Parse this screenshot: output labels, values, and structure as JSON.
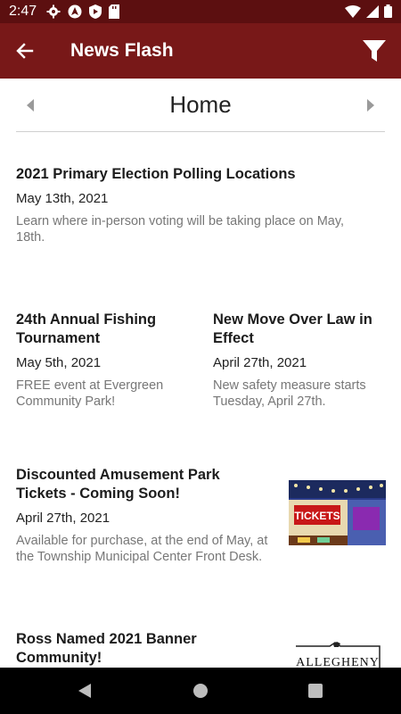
{
  "status_bar": {
    "time": "2:47",
    "left_icons": [
      "gear-icon",
      "autopilot-icon",
      "shield-play-icon",
      "sd-card-icon"
    ],
    "right_icons": [
      "wifi-icon",
      "signal-icon",
      "battery-icon"
    ]
  },
  "app_bar": {
    "title": "News Flash",
    "back_icon": "arrow-left-icon",
    "filter_icon": "filter-icon",
    "color": "#781818"
  },
  "section": {
    "title": "Home"
  },
  "articles": [
    {
      "title": "2021 Primary Election Polling Locations",
      "date": "May 13th, 2021",
      "description": "Learn where in-person voting will be taking place on May, 18th."
    },
    {
      "title": "24th Annual Fishing Tournament",
      "date": "May 5th, 2021",
      "description": "FREE event at Evergreen Community Park!"
    },
    {
      "title": "New Move Over Law in Effect",
      "date": "April 27th, 2021",
      "description": "New safety measure starts Tuesday, April 27th."
    },
    {
      "title": "Discounted Amusement Park Tickets - Coming Soon!",
      "date": "April 27th, 2021",
      "description": "Available for purchase, at the end of May, at the Township Municipal Center Front Desk.",
      "image_text": "TICKETS"
    },
    {
      "title": "Ross Named 2021 Banner Community!",
      "image_text": "ALLEGHENY"
    }
  ],
  "nav_bar": {
    "icons": [
      "back-triangle-icon",
      "home-circle-icon",
      "recents-square-icon"
    ]
  }
}
